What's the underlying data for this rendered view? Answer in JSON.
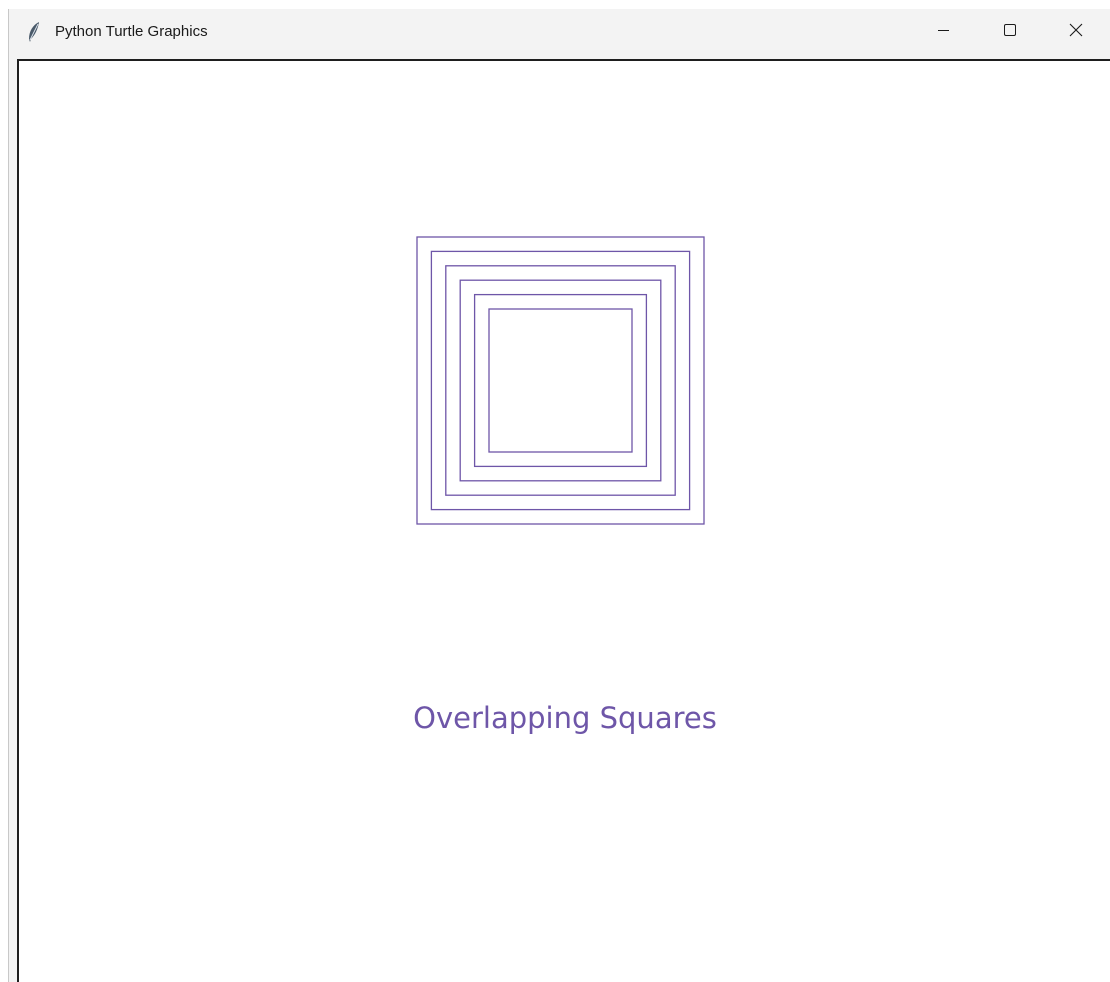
{
  "window": {
    "title": "Python Turtle Graphics",
    "controls": {
      "minimize_icon": "minimize-icon",
      "maximize_icon": "maximize-icon",
      "close_icon": "close-icon"
    }
  },
  "canvas": {
    "background": "#ffffff",
    "pen_color": "#6e56a8",
    "caption": "Overlapping Squares",
    "square_count": 6
  }
}
